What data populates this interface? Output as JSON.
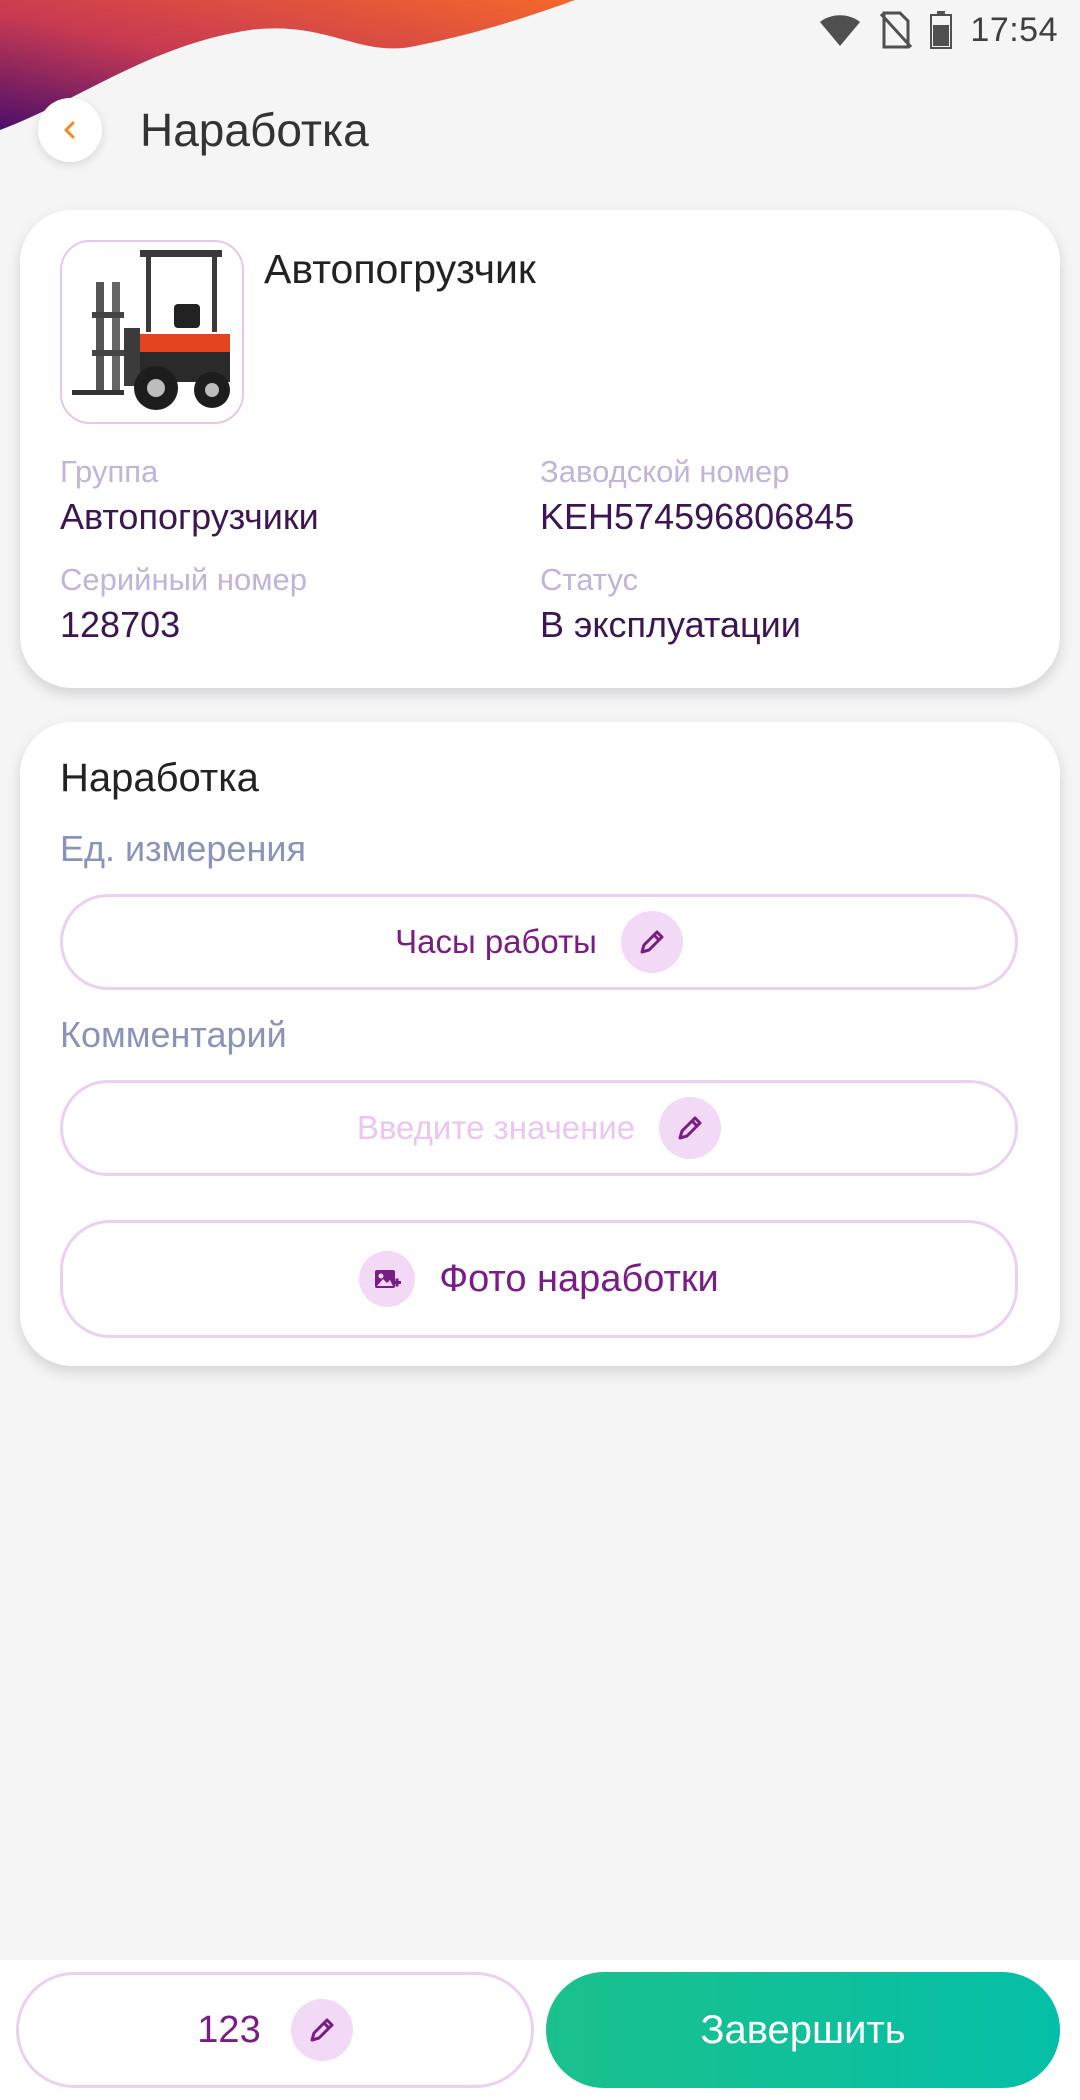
{
  "status_bar": {
    "time": "17:54"
  },
  "header": {
    "title": "Наработка"
  },
  "equipment": {
    "name": "Автопогрузчик",
    "group_label": "Группа",
    "group_value": "Автопогрузчики",
    "factory_label": "Заводской номер",
    "factory_value": "KEH574596806845",
    "serial_label": "Серийный номер",
    "serial_value": "128703",
    "status_label": "Статус",
    "status_value": "В эксплуатации"
  },
  "runtime": {
    "title": "Наработка",
    "unit_label": "Ед. измерения",
    "unit_value": "Часы работы",
    "comment_label": "Комментарий",
    "comment_placeholder": "Введите значение",
    "photo_button": "Фото наработки"
  },
  "bottom": {
    "value": "123",
    "finish_label": "Завершить"
  },
  "colors": {
    "accent_purple": "#7a1c86",
    "back_arrow": "#f08a24",
    "finish_gradient_start": "#1bc08c",
    "finish_gradient_end": "#04bfa7"
  },
  "icons": [
    "back-arrow-icon",
    "wifi-icon",
    "no-sim-icon",
    "battery-icon",
    "pencil-icon",
    "add-photo-icon"
  ]
}
